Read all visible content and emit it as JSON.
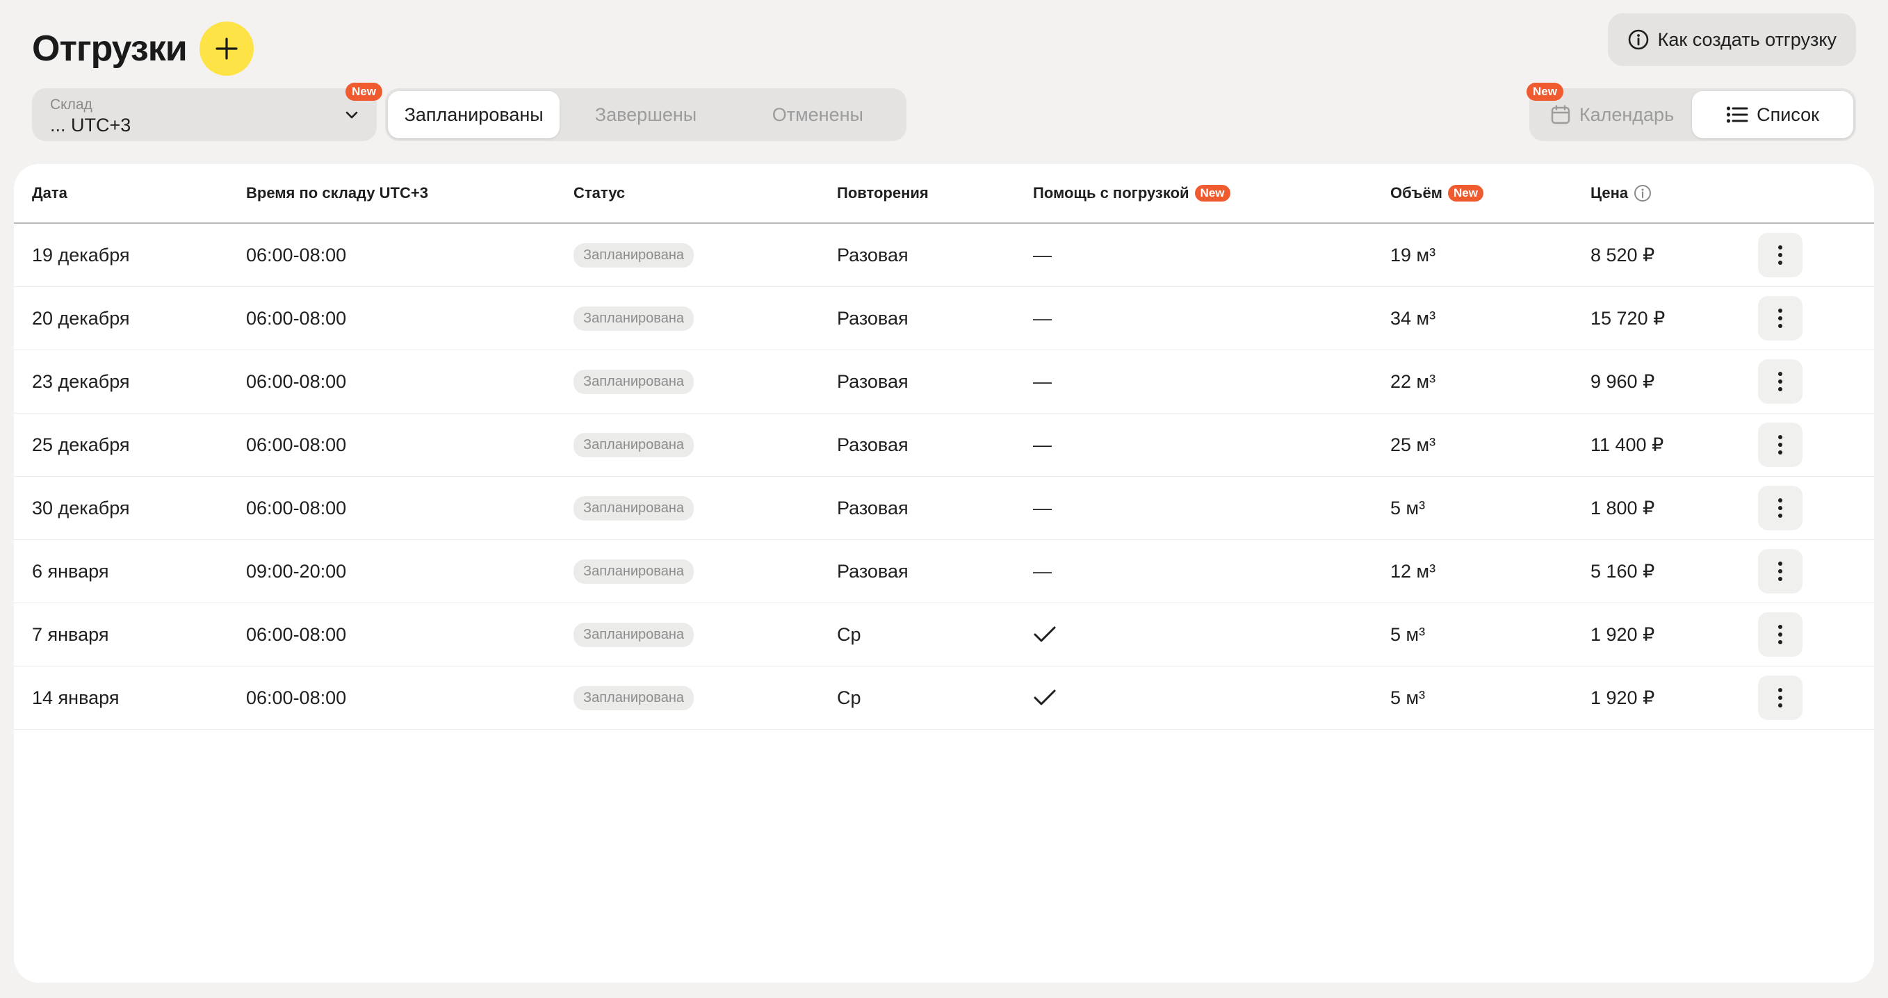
{
  "header": {
    "title": "Отгрузки",
    "add_icon": "plus-icon",
    "help_label": "Как создать отгрузку",
    "help_icon": "info-icon"
  },
  "filters": {
    "warehouse": {
      "label": "Склад",
      "value": "... UTC+3",
      "badge": "New"
    },
    "tabs": [
      {
        "label": "Запланированы",
        "active": true
      },
      {
        "label": "Завершены",
        "active": false
      },
      {
        "label": "Отменены",
        "active": false
      }
    ],
    "views": [
      {
        "label": "Календарь",
        "icon": "calendar-icon",
        "badge": "New",
        "active": false
      },
      {
        "label": "Список",
        "icon": "list-icon",
        "active": true
      }
    ]
  },
  "table": {
    "columns": [
      {
        "label": "Дата"
      },
      {
        "label": "Время по складу UTC+3"
      },
      {
        "label": "Статус"
      },
      {
        "label": "Повторения"
      },
      {
        "label": "Помощь с погрузкой",
        "badge": "New"
      },
      {
        "label": "Объём",
        "badge": "New"
      },
      {
        "label": "Цена",
        "icon": "info-icon"
      }
    ],
    "rows": [
      {
        "date": "19 декабря",
        "time": "06:00-08:00",
        "status": "Запланирована",
        "repeat": "Разовая",
        "help": "—",
        "volume": "19 м³",
        "price": "8 520 ₽"
      },
      {
        "date": "20 декабря",
        "time": "06:00-08:00",
        "status": "Запланирована",
        "repeat": "Разовая",
        "help": "—",
        "volume": "34 м³",
        "price": "15 720 ₽"
      },
      {
        "date": "23 декабря",
        "time": "06:00-08:00",
        "status": "Запланирована",
        "repeat": "Разовая",
        "help": "—",
        "volume": "22 м³",
        "price": "9 960 ₽"
      },
      {
        "date": "25 декабря",
        "time": "06:00-08:00",
        "status": "Запланирована",
        "repeat": "Разовая",
        "help": "—",
        "volume": "25 м³",
        "price": "11 400 ₽"
      },
      {
        "date": "30 декабря",
        "time": "06:00-08:00",
        "status": "Запланирована",
        "repeat": "Разовая",
        "help": "—",
        "volume": "5 м³",
        "price": "1 800 ₽"
      },
      {
        "date": "6 января",
        "time": "09:00-20:00",
        "status": "Запланирована",
        "repeat": "Разовая",
        "help": "—",
        "volume": "12 м³",
        "price": "5 160 ₽"
      },
      {
        "date": "7 января",
        "time": "06:00-08:00",
        "status": "Запланирована",
        "repeat": "Ср",
        "help": "check",
        "volume": "5 м³",
        "price": "1 920 ₽"
      },
      {
        "date": "14 января",
        "time": "06:00-08:00",
        "status": "Запланирована",
        "repeat": "Ср",
        "help": "check",
        "volume": "5 м³",
        "price": "1 920 ₽"
      }
    ]
  }
}
